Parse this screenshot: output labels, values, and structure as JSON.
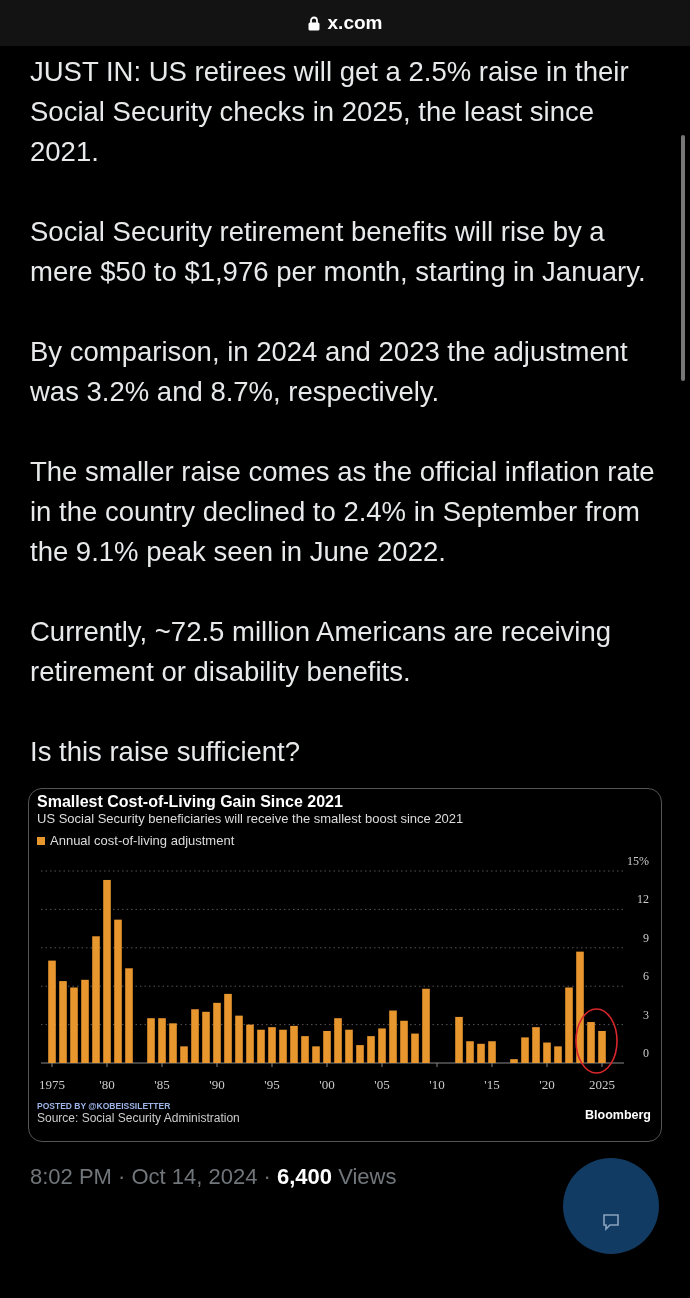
{
  "browser_bar": {
    "url": "x.com"
  },
  "post": {
    "paragraphs": [
      "JUST IN: US retirees will get a 2.5% raise in their Social Security checks in 2025, the least since 2021.",
      "Social Security retirement benefits will rise by a mere $50 to $1,976 per month, starting in January.",
      "By comparison, in 2024 and 2023 the adjustment was 3.2% and 8.7%, respectively.",
      "The smaller raise comes as the official inflation rate in the country declined to 2.4% in September from the 9.1% peak seen in June 2022.",
      "Currently, ~72.5 million Americans are receiving retirement or disability benefits.",
      "Is this raise sufficient?"
    ]
  },
  "chart_card": {
    "subtitle": "US Social Security beneficiaries will receive the smallest boost since 2021",
    "posted_by": "POSTED BY @KOBEISSILETTER",
    "source": "Source: Social Security Administration",
    "brand": "Bloomberg",
    "chart_data": {
      "type": "bar",
      "title": "Smallest Cost-of-Living Gain Since 2021",
      "x": [
        1975,
        1976,
        1977,
        1978,
        1979,
        1980,
        1981,
        1982,
        1984,
        1985,
        1986,
        1987,
        1988,
        1989,
        1990,
        1991,
        1992,
        1993,
        1994,
        1995,
        1996,
        1997,
        1998,
        1999,
        2000,
        2001,
        2002,
        2003,
        2004,
        2005,
        2006,
        2007,
        2008,
        2009,
        2010,
        2011,
        2012,
        2013,
        2014,
        2015,
        2016,
        2017,
        2018,
        2019,
        2020,
        2021,
        2022,
        2023,
        2024,
        2025
      ],
      "series": [
        {
          "name": "Annual cost-of-living adjustment",
          "color": "#e8962e",
          "values": [
            8.0,
            6.4,
            5.9,
            6.5,
            9.9,
            14.3,
            11.2,
            7.4,
            3.5,
            3.5,
            3.1,
            1.3,
            4.2,
            4.0,
            4.7,
            5.4,
            3.7,
            3.0,
            2.6,
            2.8,
            2.6,
            2.9,
            2.1,
            1.3,
            2.5,
            3.5,
            2.6,
            1.4,
            2.1,
            2.7,
            4.1,
            3.3,
            2.3,
            5.8,
            0,
            0,
            3.6,
            1.7,
            1.5,
            1.7,
            0,
            0.3,
            2.0,
            2.8,
            1.6,
            1.3,
            5.9,
            8.7,
            3.2,
            2.5
          ]
        }
      ],
      "xlim": [
        1974,
        2027
      ],
      "ylim": [
        0,
        15
      ],
      "grid": true,
      "yticks": [
        0,
        3,
        6,
        9,
        12,
        {
          "value": 15,
          "label": "15%"
        }
      ],
      "xticks": [
        {
          "value": 1975,
          "label": "1975"
        },
        {
          "value": 1980,
          "label": "'80"
        },
        {
          "value": 1985,
          "label": "'85"
        },
        {
          "value": 1990,
          "label": "'90"
        },
        {
          "value": 1995,
          "label": "'95"
        },
        {
          "value": 2000,
          "label": "'00"
        },
        {
          "value": 2005,
          "label": "'05"
        },
        {
          "value": 2010,
          "label": "'10"
        },
        {
          "value": 2015,
          "label": "'15"
        },
        {
          "value": 2020,
          "label": "'20"
        },
        {
          "value": 2025,
          "label": "2025"
        }
      ]
    }
  },
  "meta": {
    "line": "8:02 PM · Oct 14, 2024 · **6,400** Views"
  }
}
